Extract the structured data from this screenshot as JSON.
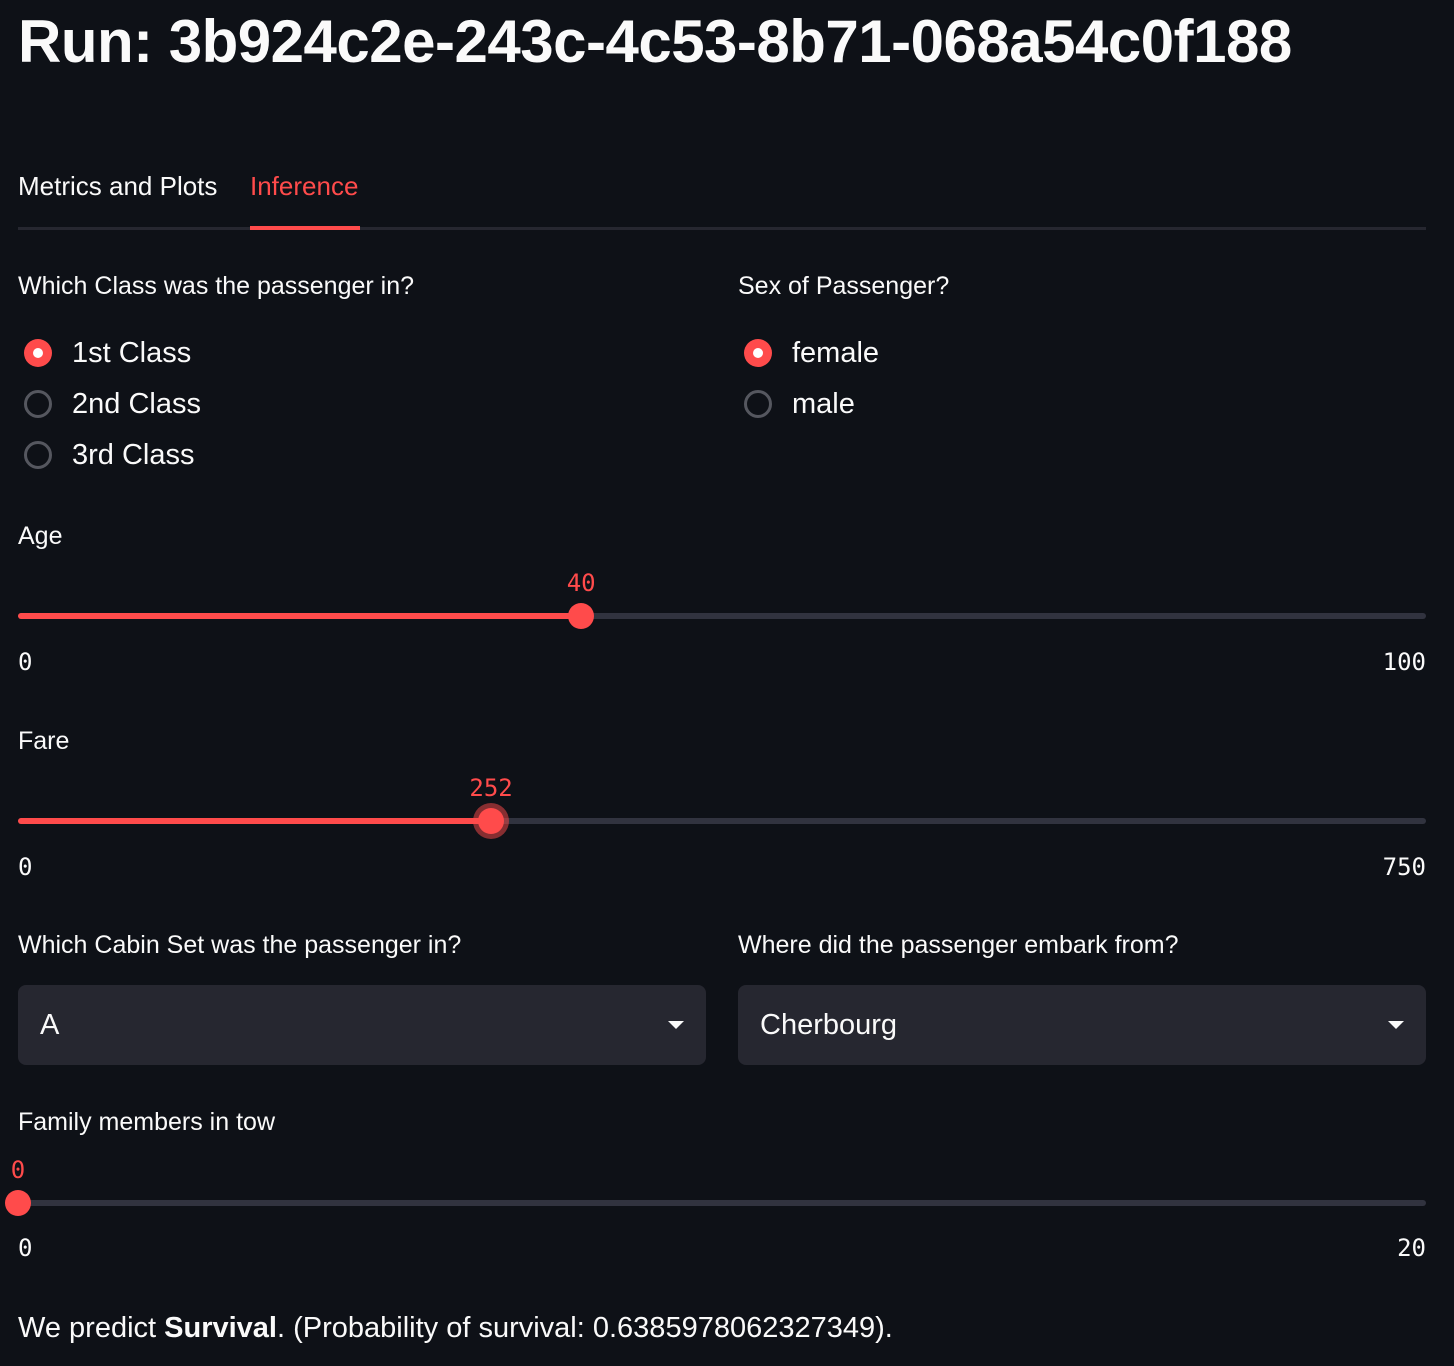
{
  "header": {
    "title": "Run: 3b924c2e-243c-4c53-8b71-068a54c0f188"
  },
  "tabs": [
    {
      "label": "Metrics and Plots",
      "active": false
    },
    {
      "label": "Inference",
      "active": true
    }
  ],
  "passenger_class": {
    "label": "Which Class was the passenger in?",
    "options": [
      "1st Class",
      "2nd Class",
      "3rd Class"
    ],
    "selected": "1st Class"
  },
  "sex": {
    "label": "Sex of Passenger?",
    "options": [
      "female",
      "male"
    ],
    "selected": "female"
  },
  "age": {
    "label": "Age",
    "value": "40",
    "min": "0",
    "max": "100",
    "fraction": 0.4
  },
  "fare": {
    "label": "Fare",
    "value": "252",
    "min": "0",
    "max": "750",
    "fraction": 0.336
  },
  "cabin": {
    "label": "Which Cabin Set was the passenger in?",
    "value": "A"
  },
  "embark": {
    "label": "Where did the passenger embark from?",
    "value": "Cherbourg"
  },
  "family": {
    "label": "Family members in tow",
    "value": "0",
    "min": "0",
    "max": "20",
    "fraction": 0
  },
  "result": {
    "prefix": "We predict ",
    "outcome": "Survival",
    "suffix": ". (Probability of survival: 0.6385978062327349)."
  },
  "colors": {
    "background": "#0e1117",
    "accent": "#ff4b4b",
    "track": "#31333f",
    "input_bg": "#262730"
  }
}
